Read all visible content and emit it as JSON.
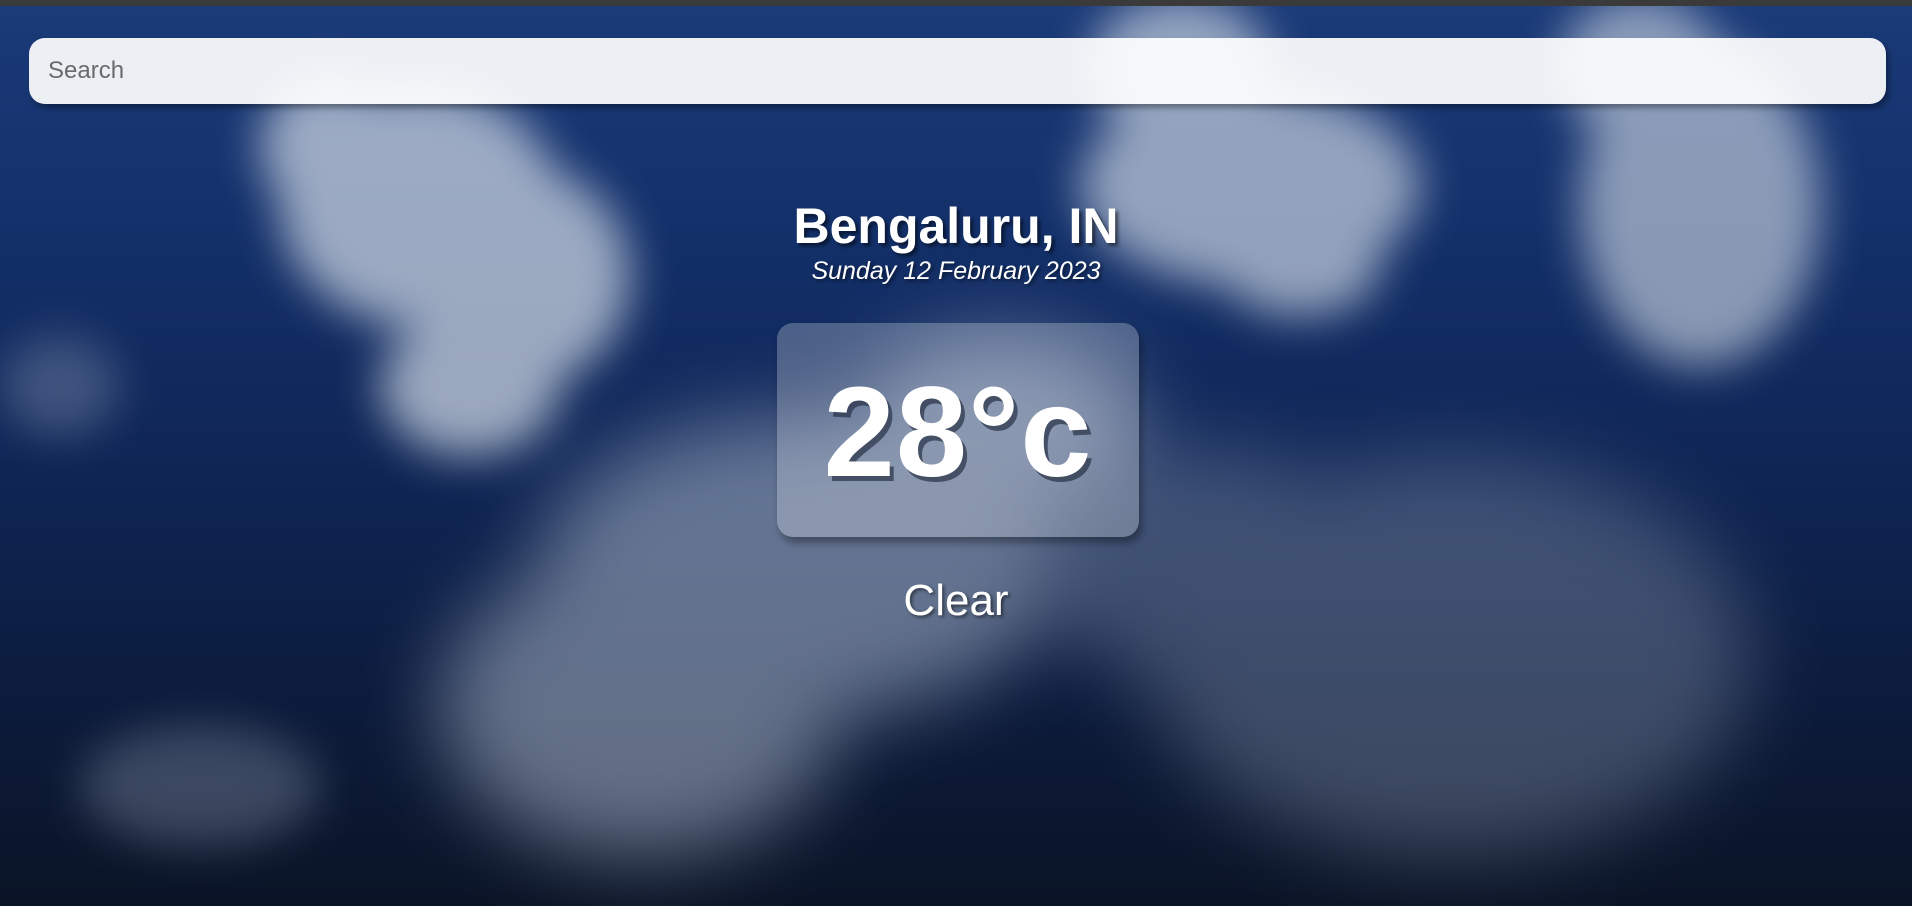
{
  "search": {
    "placeholder": "Search",
    "value": ""
  },
  "weather": {
    "location": "Bengaluru, IN",
    "date": "Sunday 12 February 2023",
    "temperature": "28°c",
    "condition": "Clear"
  },
  "colors": {
    "sky_top": "#1a3a78",
    "sky_bottom": "#0b1426",
    "text": "#ffffff"
  }
}
